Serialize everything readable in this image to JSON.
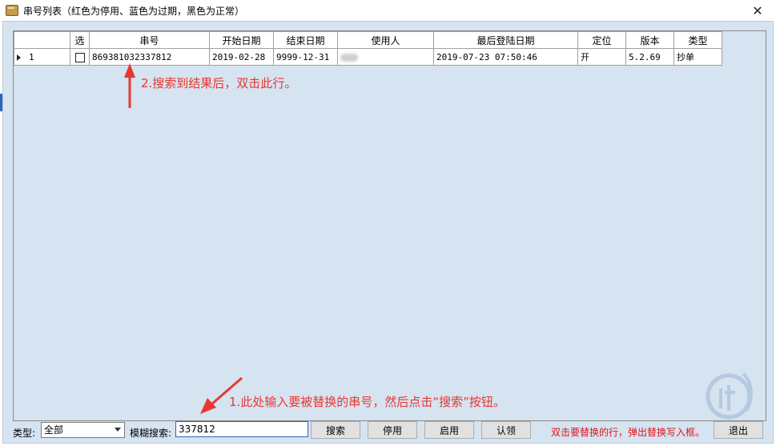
{
  "window": {
    "title": "串号列表（红色为停用、蓝色为过期，黑色为正常）",
    "close_label": "✕"
  },
  "table": {
    "columns": [
      "选",
      "串号",
      "开始日期",
      "结束日期",
      "使用人",
      "最后登陆日期",
      "定位",
      "版本",
      "类型"
    ],
    "rows": [
      {
        "index": "1",
        "serial": "869381032337812",
        "start": "2019-02-28",
        "end": "9999-12-31",
        "user": "",
        "last_login": "2019-07-23 07:50:46",
        "locate": "开",
        "version": "5.2.69",
        "type": "抄单"
      }
    ]
  },
  "annotations": {
    "step2": "2.搜索到结果后，双击此行。",
    "step1": "1.此处输入要被替换的串号，然后点击“搜索”按钮。"
  },
  "bottom": {
    "type_label": "类型:",
    "type_value": "全部",
    "search_label": "模糊搜索:",
    "search_value": "337812",
    "buttons": {
      "search": "搜索",
      "disable": "停用",
      "enable": "启用",
      "claim": "认领",
      "exit": "退出"
    },
    "hint": "双击要替换的行，弹出替换写入框。"
  },
  "colors": {
    "grid_bg": "#d6e3f0",
    "annotation": "#e8372f",
    "hint": "#e0141c",
    "selection": "#1f6fd6"
  }
}
